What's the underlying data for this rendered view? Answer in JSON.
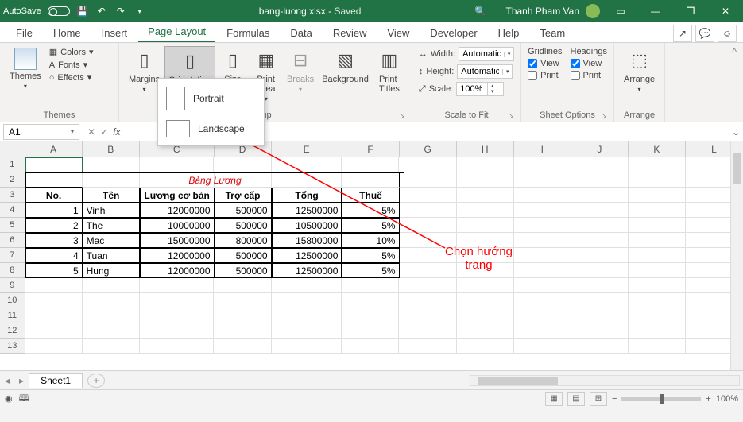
{
  "titlebar": {
    "autosave": "AutoSave",
    "filename": "bang-luong.xlsx",
    "saved": "Saved",
    "search_icon": "🔍",
    "user": "Thanh Pham Van"
  },
  "tabs": {
    "file": "File",
    "home": "Home",
    "insert": "Insert",
    "pagelayout": "Page Layout",
    "formulas": "Formulas",
    "data": "Data",
    "review": "Review",
    "view": "View",
    "developer": "Developer",
    "help": "Help",
    "team": "Team"
  },
  "ribbon": {
    "themes": {
      "themes": "Themes",
      "colors": "Colors",
      "fonts": "Fonts",
      "effects": "Effects",
      "group": "Themes"
    },
    "pagesetup": {
      "margins": "Margins",
      "orientation": "Orientation",
      "size": "Size",
      "printarea": "Print\nArea",
      "breaks": "Breaks",
      "background": "Background",
      "printtitles": "Print\nTitles",
      "group": "tup"
    },
    "scaletofit": {
      "width": "Width:",
      "height": "Height:",
      "scale": "Scale:",
      "automatic": "Automatic",
      "scaleval": "100%",
      "group": "Scale to Fit"
    },
    "sheetoptions": {
      "gridlines": "Gridlines",
      "headings": "Headings",
      "view": "View",
      "print": "Print",
      "group": "Sheet Options"
    },
    "arrange": {
      "arrange": "Arrange",
      "group": "Arrange"
    }
  },
  "dropdown": {
    "portrait": "Portrait",
    "landscape": "Landscape"
  },
  "annotation": {
    "line1": "Chọn hướng",
    "line2": "trang"
  },
  "namebox": "A1",
  "columns": [
    "",
    "A",
    "B",
    "C",
    "D",
    "E",
    "F",
    "G",
    "H",
    "I",
    "J",
    "K",
    "L"
  ],
  "table": {
    "title": "Bảng Lương",
    "headers": {
      "no": "No.",
      "ten": "Tên",
      "luong": "Lương cơ bản",
      "trocap": "Trợ cấp",
      "tong": "Tổng",
      "thue": "Thuế"
    },
    "rows": [
      {
        "no": "1",
        "ten": "Vinh",
        "luong": "12000000",
        "trocap": "500000",
        "tong": "12500000",
        "thue": "5%"
      },
      {
        "no": "2",
        "ten": "The",
        "luong": "10000000",
        "trocap": "500000",
        "tong": "10500000",
        "thue": "5%"
      },
      {
        "no": "3",
        "ten": "Mac",
        "luong": "15000000",
        "trocap": "800000",
        "tong": "15800000",
        "thue": "10%"
      },
      {
        "no": "4",
        "ten": "Tuan",
        "luong": "12000000",
        "trocap": "500000",
        "tong": "12500000",
        "thue": "5%"
      },
      {
        "no": "5",
        "ten": "Hung",
        "luong": "12000000",
        "trocap": "500000",
        "tong": "12500000",
        "thue": "5%"
      }
    ]
  },
  "sheet": {
    "name": "Sheet1"
  },
  "status": {
    "zoom": "100%"
  }
}
